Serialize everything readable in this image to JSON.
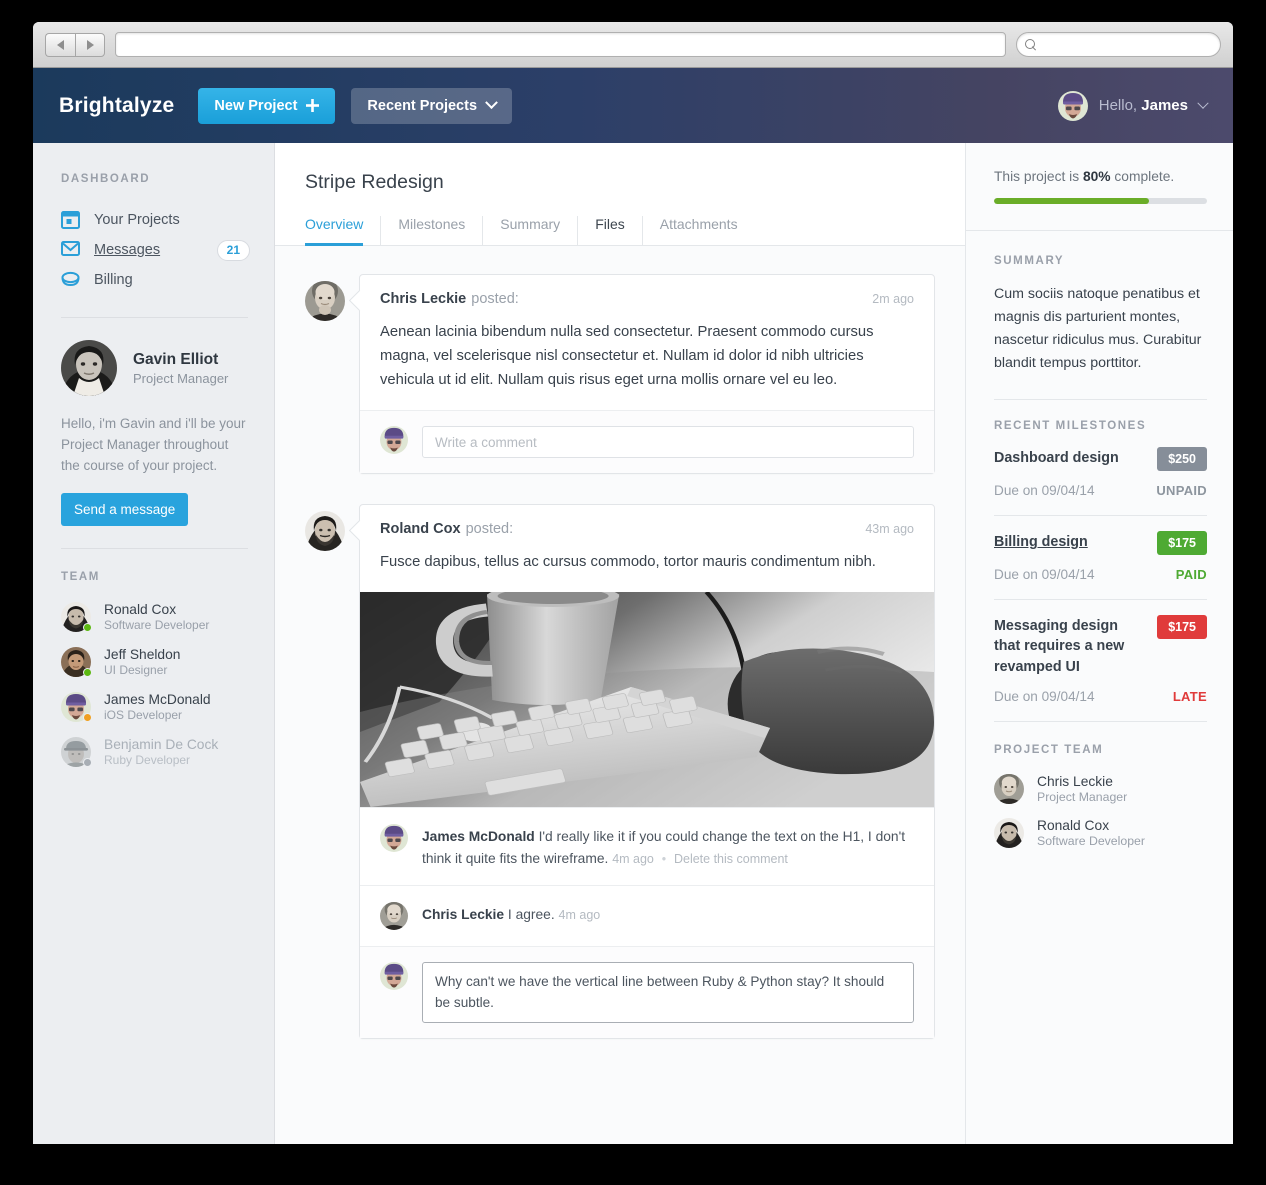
{
  "browser": {
    "back_label": "Back",
    "forward_label": "Forward",
    "url_value": "",
    "url_placeholder": "",
    "search_value": "",
    "search_placeholder": ""
  },
  "header": {
    "logo": "Brightalyze",
    "new_project_label": "New Project",
    "recent_projects_label": "Recent Projects",
    "greeting_prefix": "Hello, ",
    "greeting_name": "James"
  },
  "sidebar": {
    "dashboard_label": "DASHBOARD",
    "nav": [
      {
        "label": "Your Projects",
        "icon": "window-icon",
        "badge": ""
      },
      {
        "label": "Messages",
        "icon": "envelope-icon",
        "badge": "21"
      },
      {
        "label": "Billing",
        "icon": "disc-icon",
        "badge": ""
      }
    ],
    "manager": {
      "name": "Gavin Elliot",
      "role": "Project Manager",
      "blurb": "Hello, i'm Gavin and i'll be your Project Manager throughout the course of your project.",
      "button_label": "Send a message"
    },
    "team_label": "TEAM",
    "team": [
      {
        "name": "Ronald Cox",
        "role": "Software Developer",
        "status": "online",
        "status_color": "#5cb811"
      },
      {
        "name": "Jeff Sheldon",
        "role": "UI Designer",
        "status": "online",
        "status_color": "#5cb811"
      },
      {
        "name": "James McDonald",
        "role": "iOS Developer",
        "status": "away",
        "status_color": "#f0a020"
      },
      {
        "name": "Benjamin De Cock",
        "role": "Ruby Developer",
        "status": "offline",
        "status_color": "#a8aeb5"
      }
    ]
  },
  "main": {
    "project_title": "Stripe Redesign",
    "tabs": [
      {
        "label": "Overview",
        "state": "active"
      },
      {
        "label": "Milestones",
        "state": "normal"
      },
      {
        "label": "Summary",
        "state": "normal"
      },
      {
        "label": "Files",
        "state": "hover"
      },
      {
        "label": "Attachments",
        "state": "normal"
      }
    ],
    "posts": [
      {
        "author": "Chris Leckie",
        "verb": "posted:",
        "time": "2m ago",
        "body": "Aenean lacinia bibendum nulla sed consectetur. Praesent commodo cursus magna, vel scelerisque nisl consectetur et. Nullam id dolor id nibh ultricies vehicula ut id elit. Nullam quis risus eget urna mollis ornare vel eu leo.",
        "comment_placeholder": "Write a comment"
      },
      {
        "author": "Roland Cox",
        "verb": "posted:",
        "time": "43m ago",
        "body": "Fusce dapibus, tellus ac cursus commodo, tortor mauris condimentum nibh.",
        "image_alt": "Black and white photo of a desk with a mug, keyboard and a hand on a mouse",
        "comments": [
          {
            "author": "James McDonald",
            "text": "I'd really like it if you could change the text on the H1, I don't think it quite fits the wireframe.",
            "time": "4m ago",
            "delete_label": "Delete this comment"
          },
          {
            "author": "Chris Leckie",
            "text": "I agree.",
            "time": "4m ago",
            "delete_label": ""
          }
        ],
        "draft_comment": "Why can't we have the vertical line between Ruby & Python stay? It should be subtle."
      }
    ]
  },
  "right": {
    "progress_prefix": "This project is ",
    "progress_value": "80%",
    "progress_suffix": " complete.",
    "progress_percent": 73,
    "progress_color": "#6aad28",
    "summary_label": "SUMMARY",
    "summary_text": "Cum sociis natoque penatibus et magnis dis parturient montes, nascetur ridiculus mus. Curabitur blandit tempus porttitor.",
    "milestones_label": "RECENT MILESTONES",
    "milestones": [
      {
        "name": "Dashboard design",
        "amount": "$250",
        "amount_color": "#868e99",
        "due": "Due on 09/04/14",
        "status": "UNPAID",
        "status_kind": "unpaid",
        "link": false
      },
      {
        "name": "Billing design",
        "amount": "$175",
        "amount_color": "#4eaa33",
        "due": "Due on 09/04/14",
        "status": "PAID",
        "status_kind": "paid",
        "link": true
      },
      {
        "name": "Messaging design that requires a new revamped UI",
        "amount": "$175",
        "amount_color": "#e03b3b",
        "due": "Due on 09/04/14",
        "status": "LATE",
        "status_kind": "late",
        "link": false
      }
    ],
    "project_team_label": "PROJECT TEAM",
    "project_team": [
      {
        "name": "Chris Leckie",
        "role": "Project Manager"
      },
      {
        "name": "Ronald Cox",
        "role": "Software Developer"
      }
    ]
  }
}
